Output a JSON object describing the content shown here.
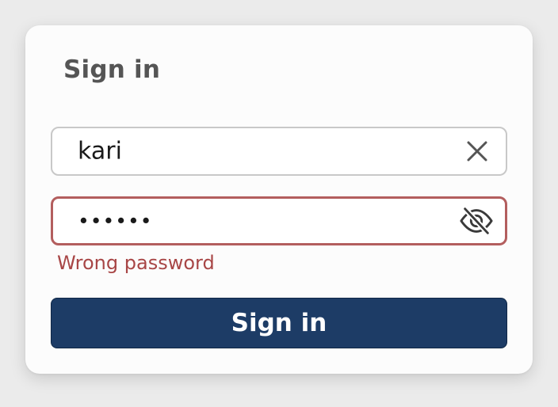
{
  "dialog": {
    "title": "Sign in"
  },
  "username": {
    "value": "kari",
    "clear_icon": "close-icon"
  },
  "password": {
    "value": "••••••",
    "visibility_icon": "eye-off-icon",
    "error_message": "Wrong password"
  },
  "submit": {
    "label": "Sign in"
  },
  "colors": {
    "primary": "#1d3c66",
    "error": "#a84646",
    "error_border": "#b35e5e"
  }
}
